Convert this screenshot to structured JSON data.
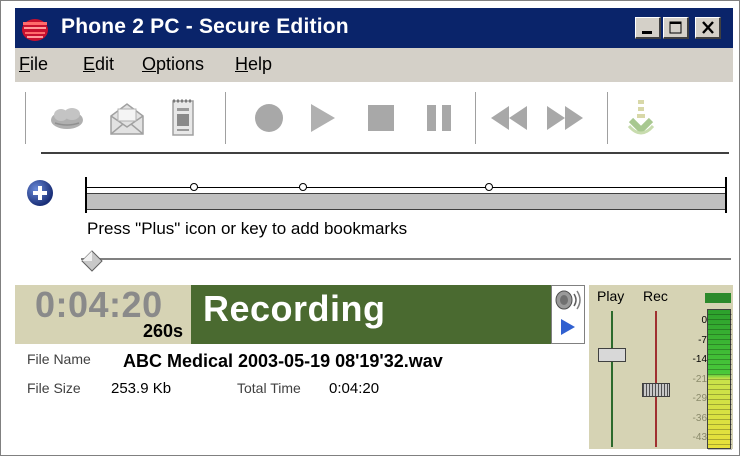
{
  "window": {
    "title": "Phone 2 PC - Secure Edition"
  },
  "menu": [
    {
      "label": "File",
      "key": "F",
      "rest": "ile"
    },
    {
      "label": "Edit",
      "key": "E",
      "rest": "dit"
    },
    {
      "label": "Options",
      "key": "O",
      "rest": "ptions"
    },
    {
      "label": "Help",
      "key": "H",
      "rest": "elp"
    }
  ],
  "toolbar": {
    "buttons": [
      "cloud-icon",
      "envelope-icon",
      "document-icon",
      "record-icon",
      "play-icon",
      "stop-icon",
      "pause-icon",
      "rewind-icon",
      "fast-forward-icon",
      "download-icon"
    ]
  },
  "timeline": {
    "hint": "Press \"Plus\" icon or key to add bookmarks",
    "bookmarks": [
      0.17,
      0.34,
      0.63
    ],
    "position": 0
  },
  "status": {
    "time": "0:04:20",
    "seconds": "260s",
    "state": "Recording",
    "file_name_label": "File Name",
    "file_name": "ABC Medical 2003-05-19 08'19'32.wav",
    "file_size_label": "File Size",
    "file_size": "253.9 Kb",
    "total_time_label": "Total Time",
    "total_time": "0:04:20"
  },
  "meters": {
    "play_label": "Play",
    "rec_label": "Rec",
    "play_volume": 0.68,
    "rec_volume": 0.42,
    "scale": [
      "0",
      "-7",
      "-14",
      "-21",
      "-29",
      "-36",
      "-43"
    ]
  },
  "colors": {
    "titlebar": "#0a246a",
    "recording_panel": "#4a6a30",
    "time_panel": "#d6d3b4",
    "level_green": "#2ca02c",
    "level_yellow": "#e8e03a"
  }
}
